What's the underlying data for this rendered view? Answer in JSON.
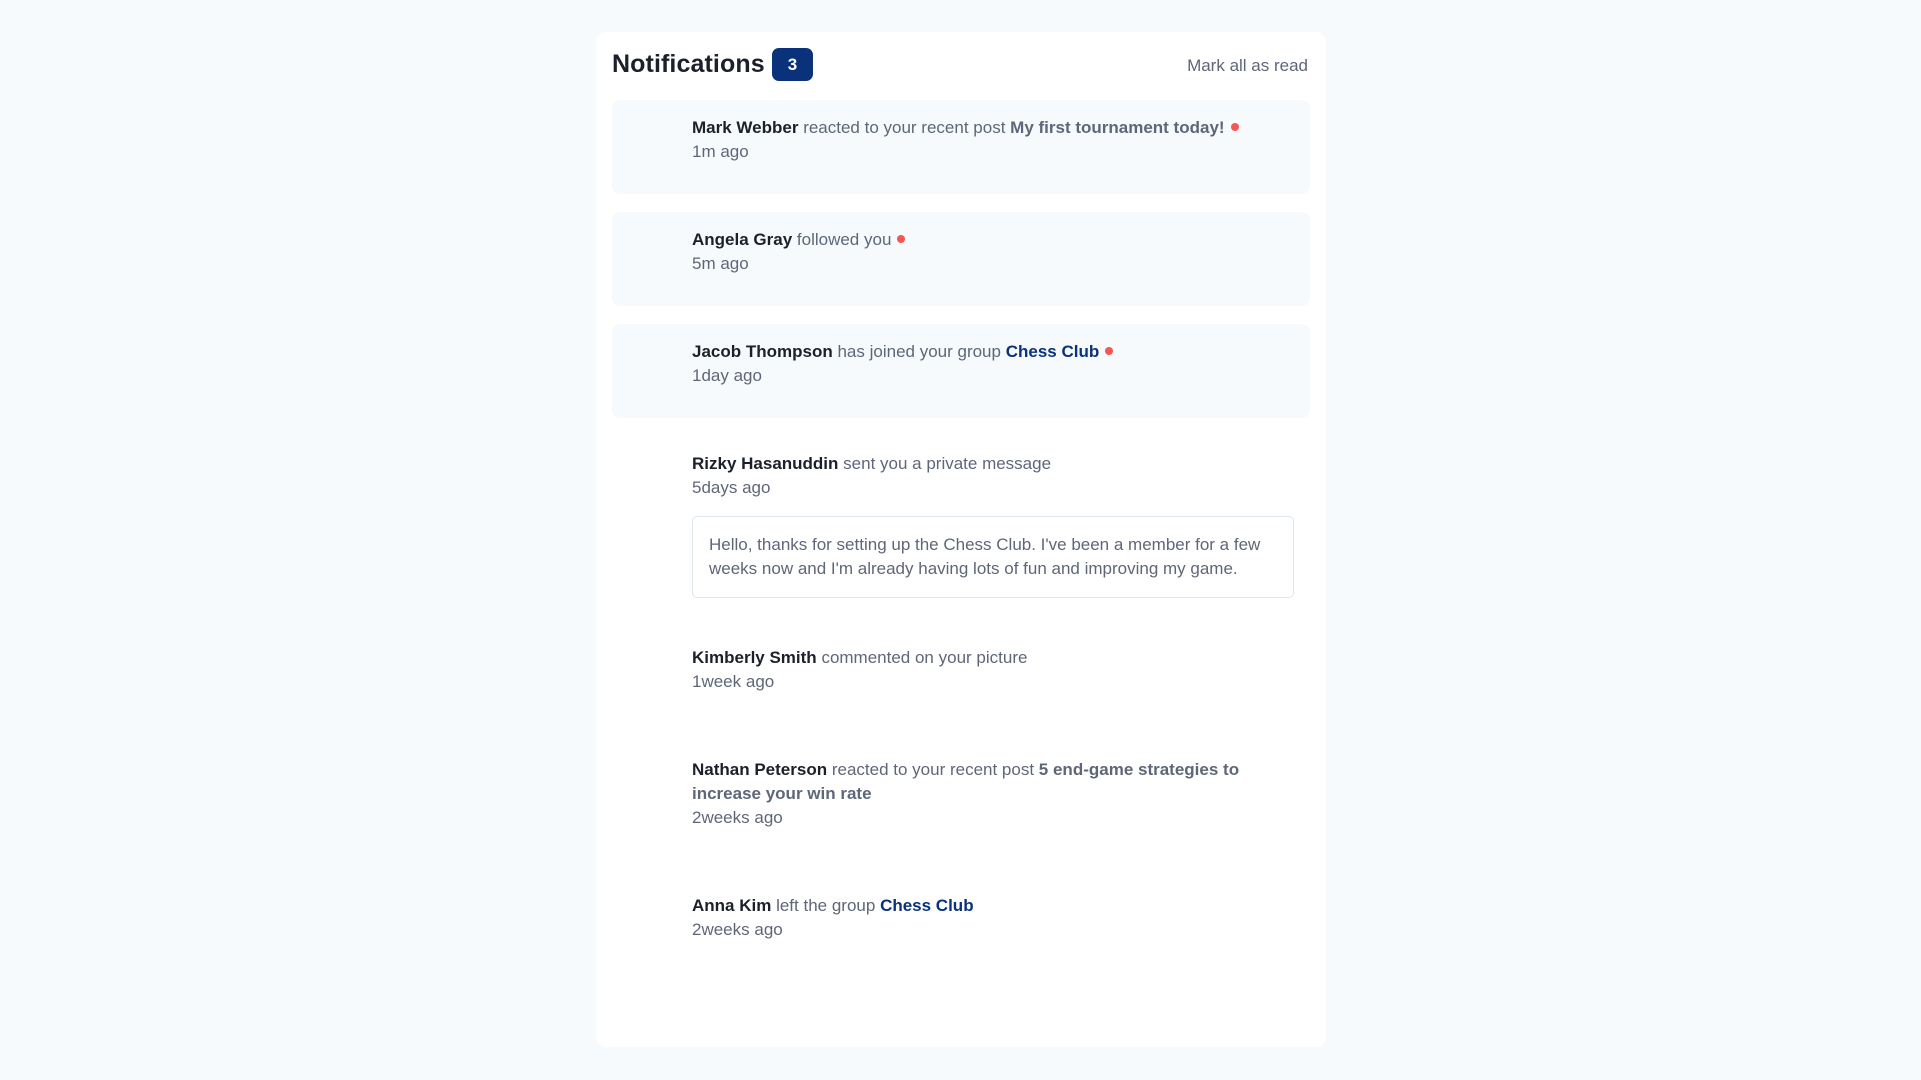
{
  "header": {
    "title": "Notifications",
    "unread_count": "3",
    "mark_all_label": "Mark all as read"
  },
  "colors": {
    "accent_blue": "#0a327b",
    "unread_dot": "#f65552",
    "unread_bg": "#f6fafd"
  },
  "notifications": [
    {
      "name": "Mark Webber",
      "action": "reacted to your recent post",
      "post": "My first tournament today!",
      "time": "1m ago",
      "unread": true
    },
    {
      "name": "Angela Gray",
      "action": "followed you",
      "time": "5m ago",
      "unread": true
    },
    {
      "name": "Jacob Thompson",
      "action": "has joined your group",
      "group": "Chess Club",
      "time": "1day ago",
      "unread": true
    },
    {
      "name": "Rizky Hasanuddin",
      "action": "sent you a private message",
      "time": "5days ago",
      "message": "Hello, thanks for setting up the Chess Club. I've been a member for a few weeks now and I'm already having lots of fun and improving my game.",
      "unread": false
    },
    {
      "name": "Kimberly Smith",
      "action": "commented on your picture",
      "time": "1week ago",
      "unread": false
    },
    {
      "name": "Nathan Peterson",
      "action": "reacted to your recent post",
      "post": "5 end-game strategies to increase your win rate",
      "time": "2weeks ago",
      "unread": false
    },
    {
      "name": "Anna Kim",
      "action": "left the group",
      "group": "Chess Club",
      "time": "2weeks ago",
      "unread": false
    }
  ]
}
